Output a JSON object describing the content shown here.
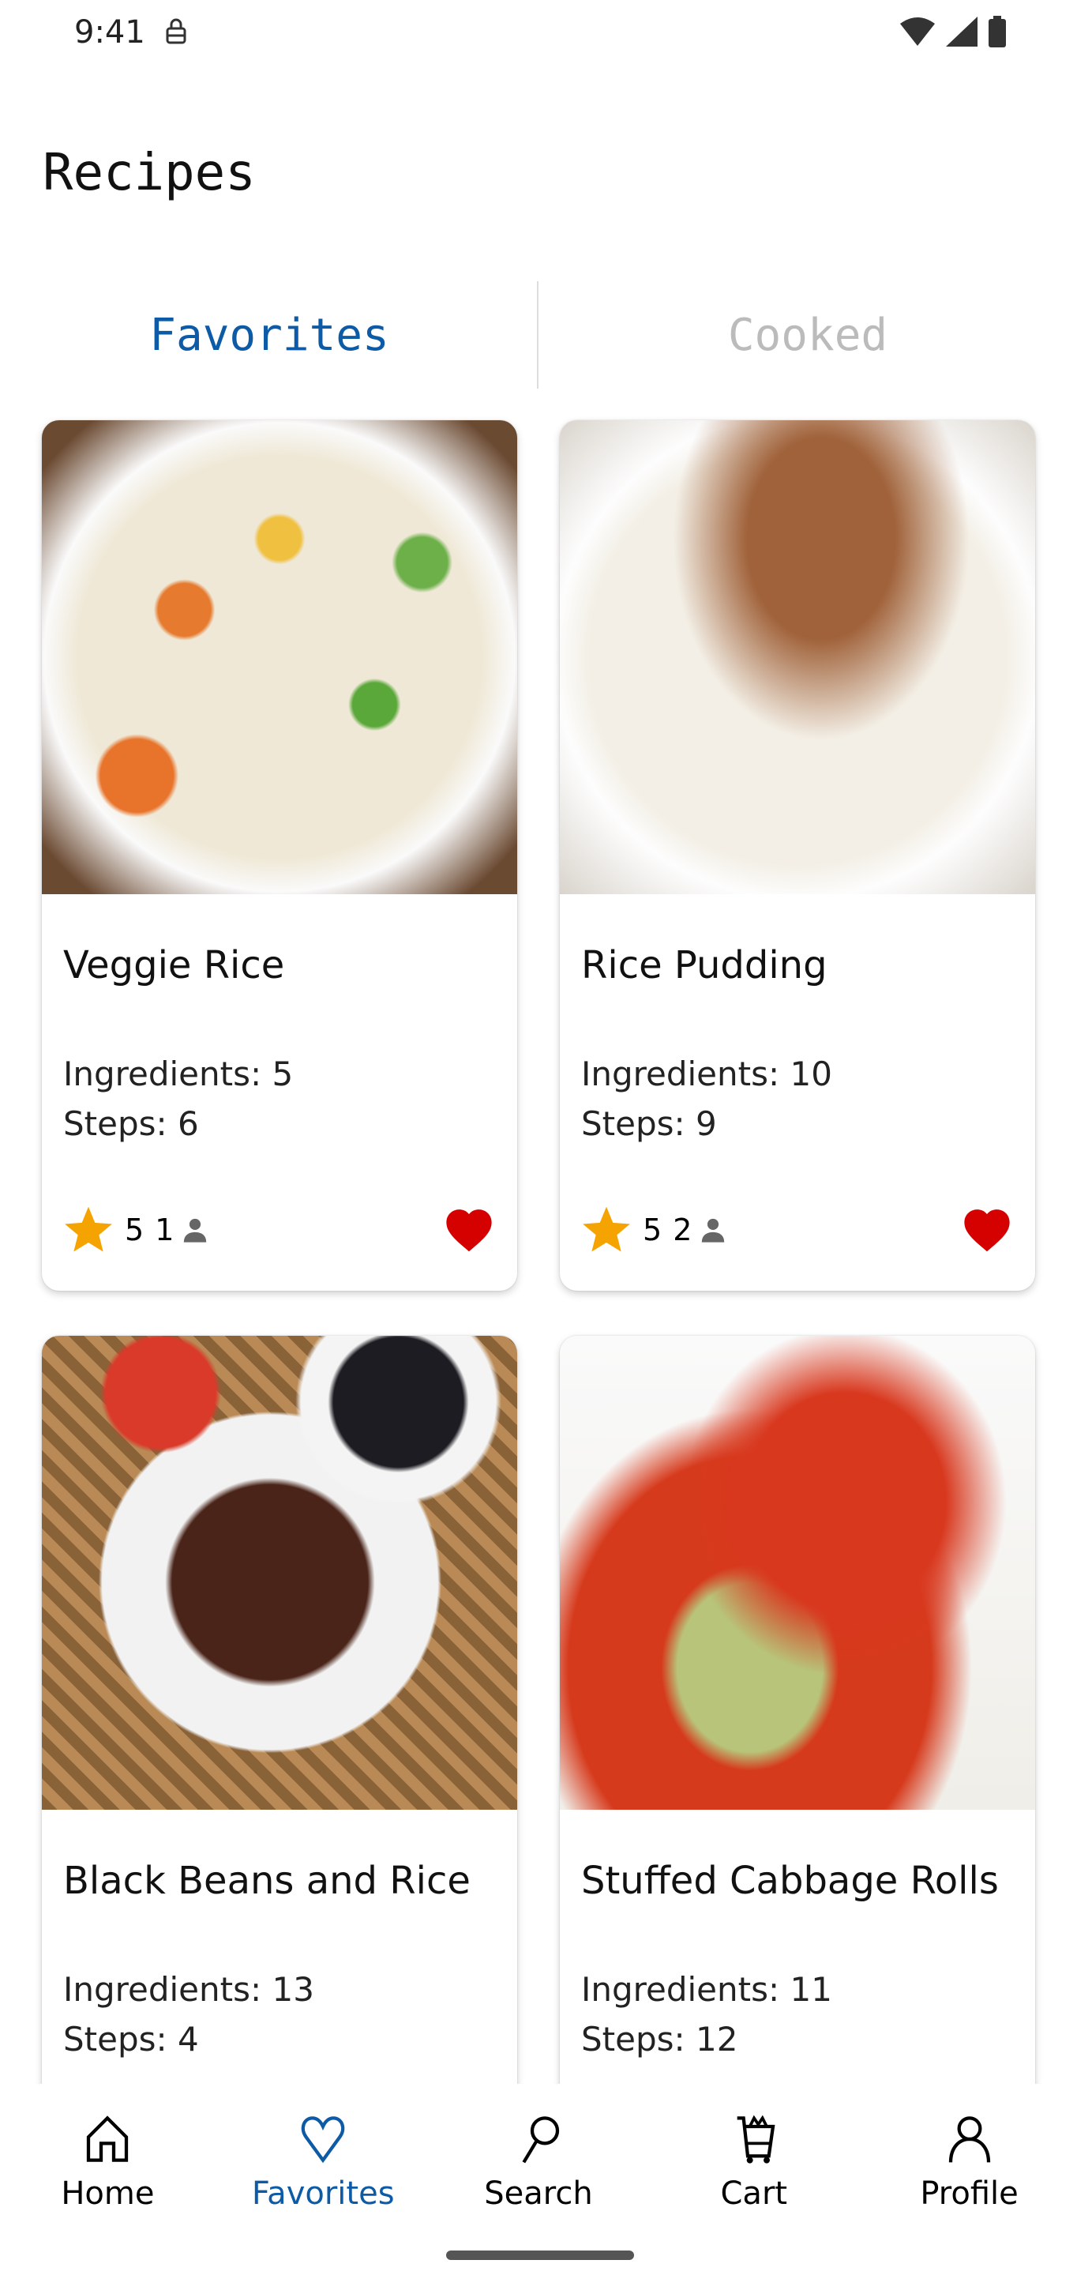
{
  "status_bar": {
    "time": "9:41"
  },
  "header": {
    "title": "Recipes"
  },
  "tabs": [
    {
      "label": "Favorites",
      "active": true
    },
    {
      "label": "Cooked",
      "active": false
    }
  ],
  "recipes": [
    {
      "name": "Veggie Rice",
      "ingredients": "Ingredients: 5",
      "steps": "Steps: 6",
      "rating": "5",
      "reviews": "1",
      "favorite": true
    },
    {
      "name": "Rice Pudding",
      "ingredients": "Ingredients: 10",
      "steps": "Steps: 9",
      "rating": "5",
      "reviews": "2",
      "favorite": true
    },
    {
      "name": "Black Beans and Rice",
      "ingredients": "Ingredients: 13",
      "steps": "Steps: 4"
    },
    {
      "name": "Stuffed Cabbage Rolls",
      "ingredients": "Ingredients: 11",
      "steps": "Steps: 12"
    }
  ],
  "bottom_nav": [
    {
      "label": "Home",
      "icon": "home-icon"
    },
    {
      "label": "Favorites",
      "icon": "heart-icon",
      "active": true
    },
    {
      "label": "Search",
      "icon": "search-icon"
    },
    {
      "label": "Cart",
      "icon": "cart-icon"
    },
    {
      "label": "Profile",
      "icon": "profile-icon"
    }
  ],
  "colors": {
    "accent": "#0d5ba7",
    "star": "#f5a300",
    "heart": "#d50000"
  }
}
